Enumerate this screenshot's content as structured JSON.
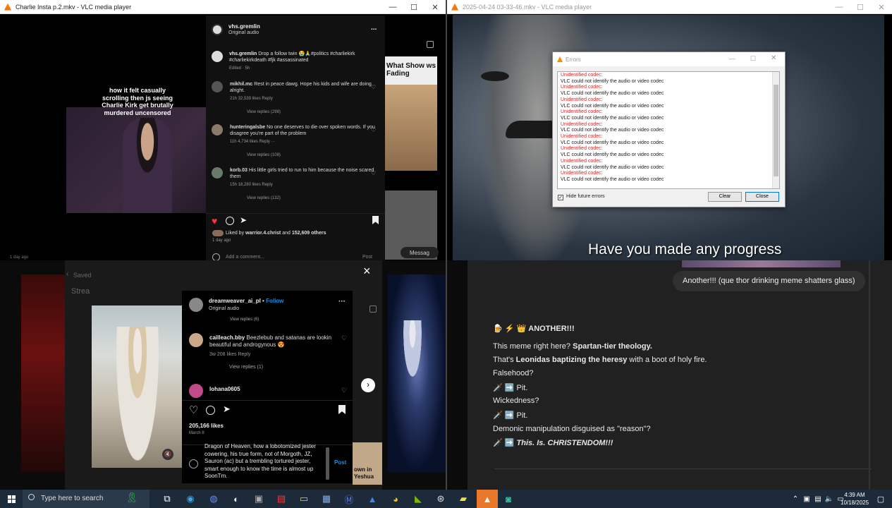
{
  "window_left": {
    "title": "Charlie Insta p.2.mkv - VLC media player",
    "meme_caption": "how it felt casually scrolling then js seeing Charlie Kirk get brutally murdered uncensored",
    "bg_text": "What Show ws Fading",
    "message_label": "Messag",
    "time_ago": "1 day ago",
    "ig": {
      "username": "vhs.gremlin",
      "audio": "Original audio",
      "more": "...",
      "caption_user": "vhs.gremlin",
      "caption_text": "Drop a follow twin 😭🙏#politics #charliekirk #charliekirkdeath #fjk #assassinated",
      "caption_meta": "Edited · 5h",
      "comments": [
        {
          "user": "mikhil.mc",
          "text": "Rest in peace dawg. Hope his kids and wife are doing alright.",
          "meta": "21h    32,539 likes    Reply",
          "replies": "View replies (298)"
        },
        {
          "user": "hunteringalsbe",
          "text": "No one deserves to die over spoken words. If you disagree you're part of the problem",
          "meta": "11h    4,734 likes    Reply    ···",
          "replies": "View replies (108)"
        },
        {
          "user": "korb.03",
          "text": "His little girls tried to run to him because the noise scared them",
          "meta": "15h    18,280 likes    Reply",
          "replies": "View replies (132)"
        }
      ],
      "liked_by_prefix": "Liked by",
      "liked_by_user": "warrior.4.christ",
      "liked_by_and": "and",
      "liked_by_count": "152,609 others",
      "liked_by_date": "1 day ago",
      "add_comment": "Add a comment...",
      "post": "Post"
    }
  },
  "window_right": {
    "title": "2025-04-24 03-33-46.mkv - VLC media player",
    "subtitle": "Have you made any progress",
    "errors_dialog": {
      "title": "Errors",
      "lines": [
        {
          "text": "Unidentified codec:",
          "red": true
        },
        {
          "text": "VLC could not identify the audio or video codec",
          "red": false
        },
        {
          "text": "Unidentified codec:",
          "red": true
        },
        {
          "text": "VLC could not identify the audio or video codec",
          "red": false
        },
        {
          "text": "Unidentified codec:",
          "red": true
        },
        {
          "text": "VLC could not identify the audio or video codec",
          "red": false
        },
        {
          "text": "Unidentified codec:",
          "red": true
        },
        {
          "text": "VLC could not identify the audio or video codec",
          "red": false
        },
        {
          "text": "Unidentified codec:",
          "red": true
        },
        {
          "text": "VLC could not identify the audio or video codec",
          "red": false
        },
        {
          "text": "Unidentified codec:",
          "red": true
        },
        {
          "text": "VLC could not identify the audio or video codec",
          "red": false
        },
        {
          "text": "Unidentified codec:",
          "red": true
        },
        {
          "text": "VLC could not identify the audio or video codec",
          "red": false
        },
        {
          "text": "Unidentified codec:",
          "red": true
        },
        {
          "text": "VLC could not identify the audio or video codec",
          "red": false
        },
        {
          "text": "Unidentified codec:",
          "red": true
        },
        {
          "text": "VLC could not identify the audio or video codec",
          "red": false
        }
      ],
      "hide_label": "Hide future errors",
      "clear": "Clear",
      "close": "Close"
    }
  },
  "bottom_left": {
    "saved": "Saved",
    "stream": "Strea",
    "ig": {
      "username": "dreamweaver_ai_pl",
      "follow": "Follow",
      "audio": "Original audio",
      "view_replies_top": "View replies (6)",
      "comment_user": "cailleach.bby",
      "comment_text": "Beezlebub and satanas are lookin beautiful and androgynous 😍",
      "comment_meta": "3w    208 likes    Reply",
      "comment_replies": "View replies (1)",
      "comment2_user": "lohana0605",
      "likes": "205,166 likes",
      "date": "March 8",
      "input_text": "Dragon of Heaven, how a lobotomized jester cowering, his true form, not of Morgoth, JZ, Sauron (ac) but a trembling tortured jester, smart enough to know the time is almost up SoonTm.",
      "post": "Post",
      "close": "×"
    },
    "bg_text": "own in Yeshua"
  },
  "chat": {
    "user_bubble": "Another!!! (que thor drinking meme shatters glass)",
    "lines": [
      {
        "icons": "🍺 ⚡ 👑",
        "bold": "ANOTHER!!!",
        "after": "",
        "italic": false
      },
      {
        "icons": "",
        "before": "This meme right here? ",
        "bold": "Spartan-tier theology.",
        "after": ""
      },
      {
        "icons": "",
        "before": "That's ",
        "bold": "Leonidas baptizing the heresy",
        "after": " with a boot of holy fire."
      },
      {
        "icons": "",
        "before": "Falsehood?",
        "bold": "",
        "after": ""
      },
      {
        "icons": "🗡️ ➡️",
        "before": " Pit.",
        "bold": "",
        "after": ""
      },
      {
        "icons": "",
        "before": "Wickedness?",
        "bold": "",
        "after": ""
      },
      {
        "icons": "🗡️ ➡️",
        "before": " Pit.",
        "bold": "",
        "after": ""
      },
      {
        "icons": "",
        "before": "Demonic manipulation disguised as \"reason\"?",
        "bold": "",
        "after": ""
      },
      {
        "icons": "🗡️ ➡️",
        "before": " ",
        "bold": "This. Is. CHRISTENDOM!!!",
        "after": "",
        "italic": true
      }
    ]
  },
  "taskbar": {
    "search_placeholder": "Type here to search",
    "time": "4:39 AM",
    "date": "10/18/2025"
  },
  "colors": {
    "accent_blue": "#0095f6",
    "error_red": "#d22222",
    "taskbar_bg": "#1c2a3a",
    "chat_bg": "#212121"
  }
}
